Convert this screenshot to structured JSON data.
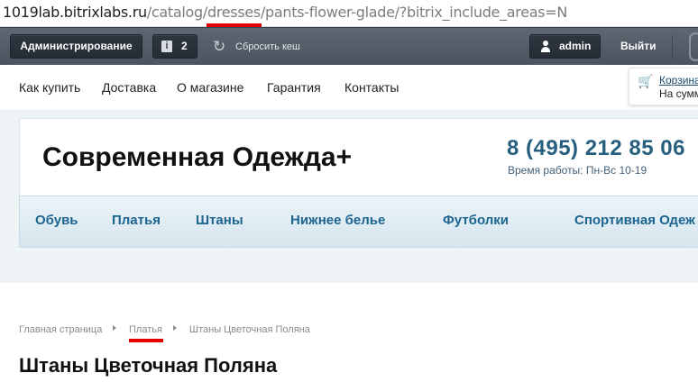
{
  "url": {
    "host": "1019lab.bitrixlabs.ru",
    "path_prefix": "/catalog/",
    "highlighted_segment": "dresses",
    "path_rest": "/pants-flower-glade/?bitrix_include_areas=N"
  },
  "admin_bar": {
    "admin_label": "Администрирование",
    "notifications_count": "2",
    "info_glyph": "i",
    "clear_cache_label": "Сбросить кеш",
    "user_name": "admin",
    "logout_label": "Выйти"
  },
  "top_links": [
    "Как купить",
    "Доставка",
    "О магазине",
    "Гарантия",
    "Контакты"
  ],
  "cart": {
    "label": "Корзина",
    "sum_text": "На сумм"
  },
  "header": {
    "site_title": "Современная Одежда+",
    "phone": "8 (495) 212 85 06",
    "hours": "Время работы: Пн-Вс 10-19"
  },
  "catalog_nav": [
    "Обувь",
    "Платья",
    "Штаны",
    "Нижнее белье",
    "Футболки",
    "Спортивная Одеж"
  ],
  "breadcrumb": [
    "Главная страница",
    "Платья",
    "Штаны Цветочная Поляна"
  ],
  "page_title": "Штаны Цветочная Поляна",
  "icons": {
    "refresh": "refresh-icon",
    "cart": "cart-icon",
    "user": "user-icon",
    "info": "info-icon"
  },
  "colors": {
    "admin_bar": "#4b545e",
    "annotation_red": "#e30000",
    "phone_blue": "#27607f",
    "nav_blue": "#1d6591"
  }
}
